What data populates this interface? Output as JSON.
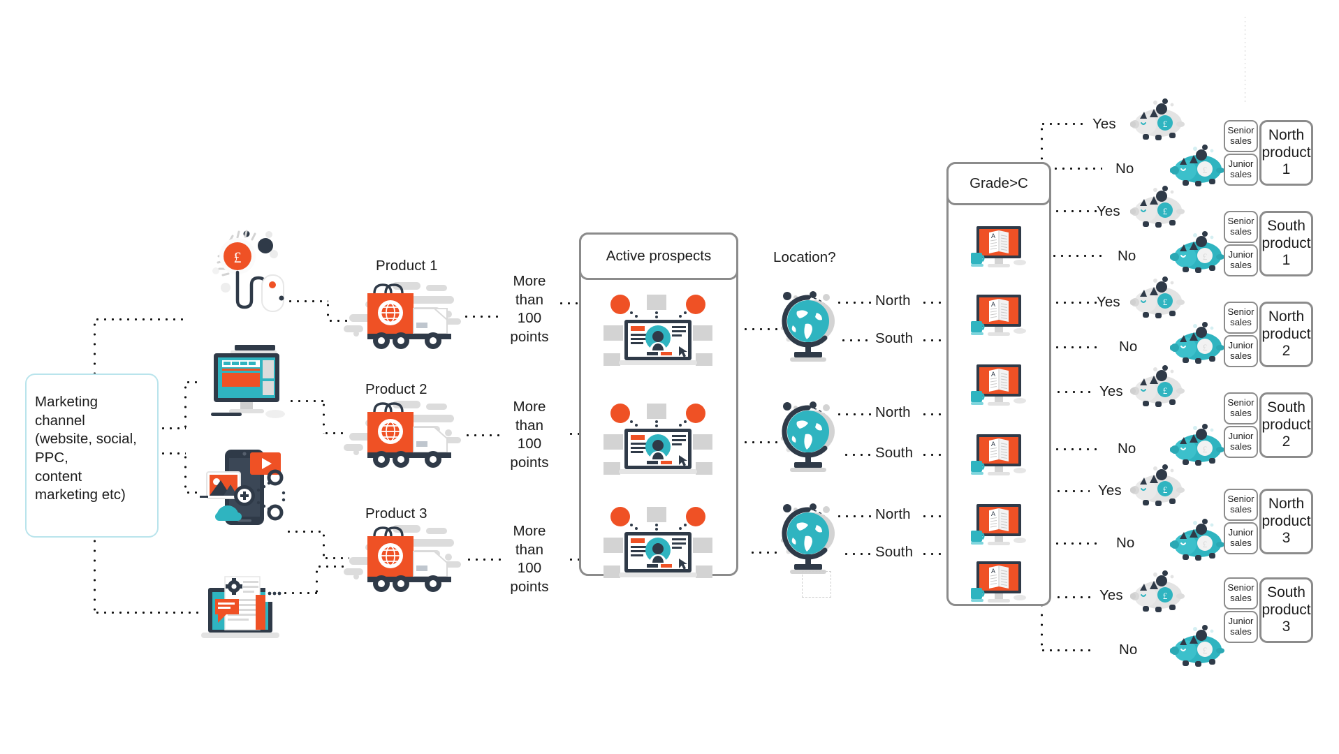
{
  "diagram": {
    "title": "Marketing lead routing decision tree",
    "colors": {
      "orange": "#ef5125",
      "teal": "#2fb4c0",
      "navy": "#2f3a48",
      "light_gray": "#d8d8d8",
      "border_gray": "#8b8b8b",
      "cyan_border": "#b9e4ec",
      "text": "#1c1c1c"
    }
  },
  "source": {
    "label": "Marketing\nchannel\n(website, social,\nPPC,\ncontent\nmarketing etc)"
  },
  "channel_icons": [
    {
      "name": "ppc-money-mouse-icon",
      "alt": "PPC pound coin with mouse"
    },
    {
      "name": "website-monitor-icon",
      "alt": "Website desktop monitor"
    },
    {
      "name": "social-mobile-icon",
      "alt": "Social media mobile phone"
    },
    {
      "name": "content-marketing-laptop-icon",
      "alt": "Content marketing laptop"
    }
  ],
  "products": [
    {
      "label": "Product 1",
      "threshold": "More\nthan\n100\npoints"
    },
    {
      "label": "Product 2",
      "threshold": "More\nthan\n100\npoints"
    },
    {
      "label": "Product 3",
      "threshold": "More\nthan\n100\npoints"
    }
  ],
  "prospects": {
    "header": "Active prospects",
    "rows": 3,
    "icon": "prospect-profile-icon"
  },
  "location": {
    "question": "Location?",
    "branches": [
      "North",
      "South"
    ],
    "groups": 3,
    "icon": "globe-icon"
  },
  "grade": {
    "header": "Grade>C",
    "rows": 6,
    "icon": "grade-monitor-icon"
  },
  "decisions": [
    {
      "answer": "Yes",
      "piggy": "piggy-bank-gray-icon"
    },
    {
      "answer": "No",
      "piggy": "piggy-bank-teal-icon"
    },
    {
      "answer": "Yes",
      "piggy": "piggy-bank-gray-icon"
    },
    {
      "answer": "No",
      "piggy": "piggy-bank-teal-icon"
    },
    {
      "answer": "Yes",
      "piggy": "piggy-bank-gray-icon"
    },
    {
      "answer": "No",
      "piggy": "piggy-bank-teal-icon"
    },
    {
      "answer": "Yes",
      "piggy": "piggy-bank-gray-icon"
    },
    {
      "answer": "No",
      "piggy": "piggy-bank-teal-icon"
    },
    {
      "answer": "Yes",
      "piggy": "piggy-bank-gray-icon"
    },
    {
      "answer": "No",
      "piggy": "piggy-bank-teal-icon"
    },
    {
      "answer": "Yes",
      "piggy": "piggy-bank-gray-icon"
    },
    {
      "answer": "No",
      "piggy": "piggy-bank-teal-icon"
    }
  ],
  "results": [
    {
      "senior": "Senior\nsales",
      "junior": "Junior\nsales",
      "outcome": "North\nproduct\n1"
    },
    {
      "senior": "Senior\nsales",
      "junior": "Junior\nsales",
      "outcome": "South\nproduct\n1"
    },
    {
      "senior": "Senior\nsales",
      "junior": "Junior\nsales",
      "outcome": "North\nproduct\n2"
    },
    {
      "senior": "Senior\nsales",
      "junior": "Junior\nsales",
      "outcome": "South\nproduct\n2"
    },
    {
      "senior": "Senior\nsales",
      "junior": "Junior\nsales",
      "outcome": "North\nproduct\n3"
    },
    {
      "senior": "Senior\nsales",
      "junior": "Junior\nsales",
      "outcome": "South\nproduct\n3"
    }
  ]
}
